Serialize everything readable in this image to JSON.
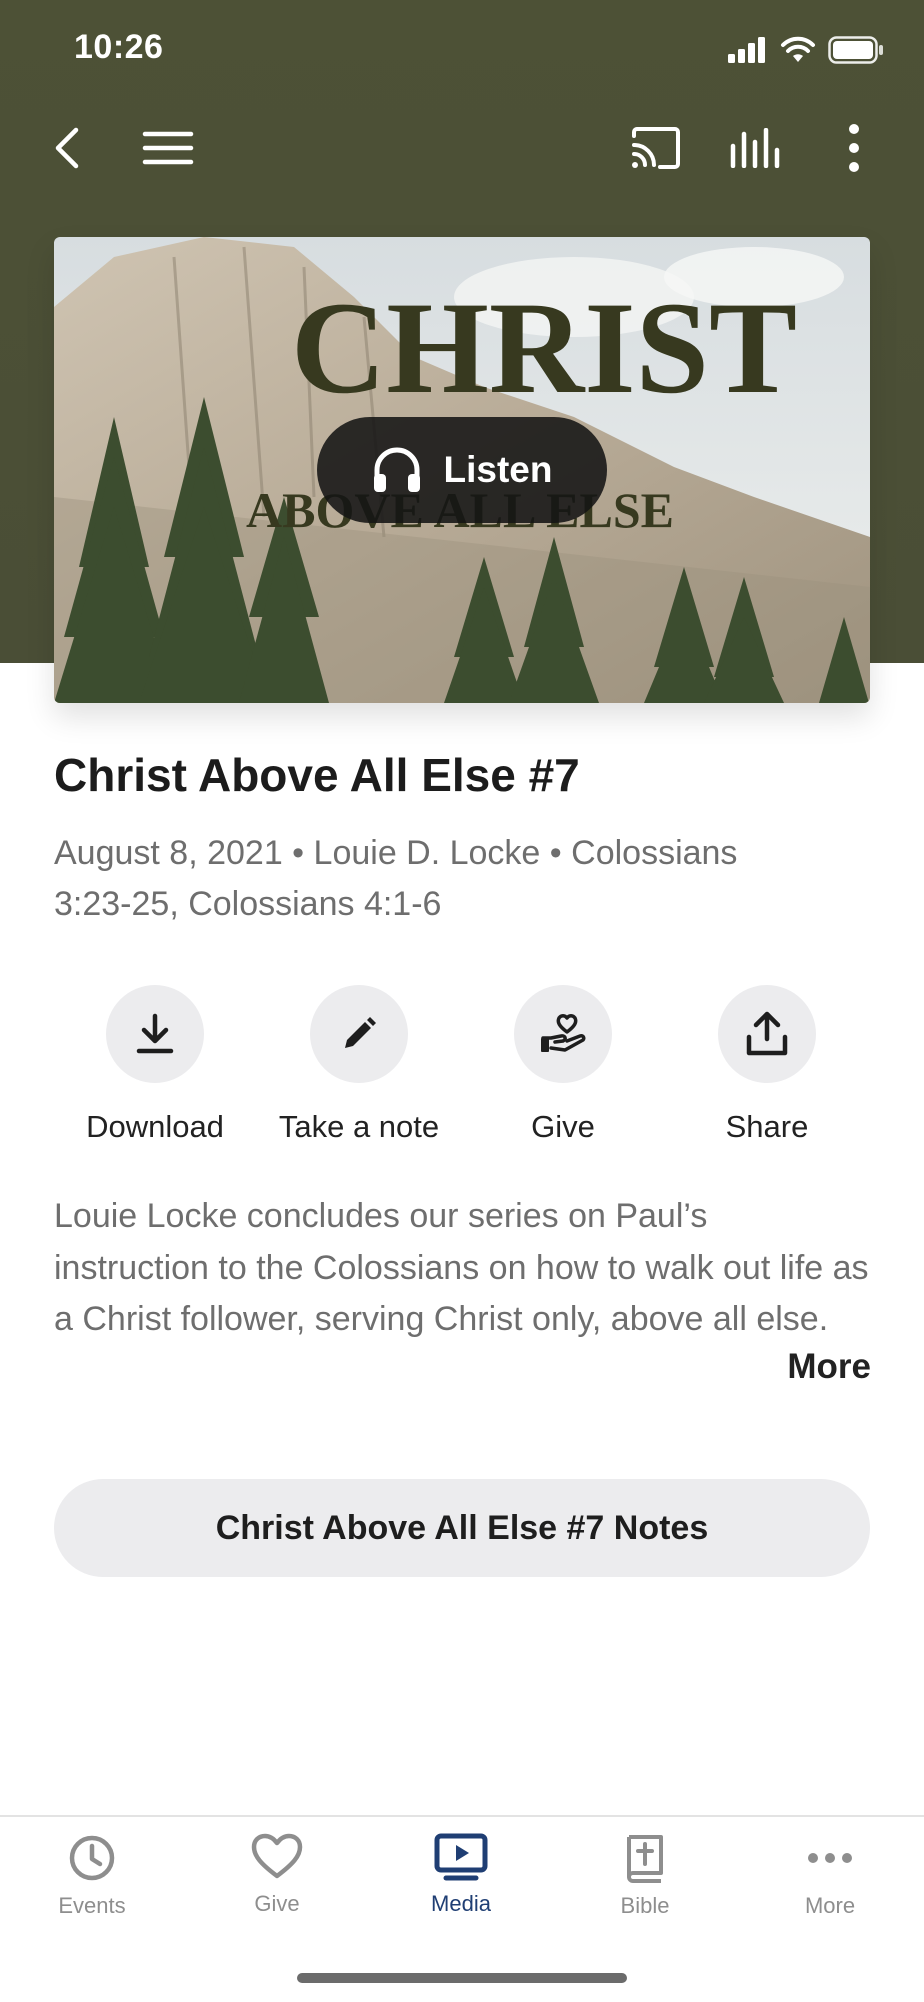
{
  "status_bar": {
    "time": "10:26"
  },
  "top_bar": {
    "icons": [
      "back-chevron-icon",
      "menu-icon",
      "cast-icon",
      "audio-bars-icon",
      "more-vertical-icon"
    ]
  },
  "artwork": {
    "title_line1": "CHRIST",
    "title_line2": "ABOVE ALL ELSE",
    "listen_label": "Listen"
  },
  "sermon": {
    "title": "Christ Above All Else #7",
    "meta_line1": "August 8, 2021 • Louie D. Locke • Colossians",
    "meta_line2": "3:23-25, Colossians 4:1-6"
  },
  "actions": [
    {
      "label": "Download",
      "icon": "download-icon"
    },
    {
      "label": "Take a note",
      "icon": "pencil-icon"
    },
    {
      "label": "Give",
      "icon": "heart-hand-icon"
    },
    {
      "label": "Share",
      "icon": "share-icon"
    }
  ],
  "description": {
    "text": "Louie Locke concludes our series on Paul’s instruction to the Colossians on how to walk out life as a Christ follower, serving Christ only, above all else.",
    "more_label": "More"
  },
  "notes_button": {
    "label": "Christ Above All Else #7 Notes"
  },
  "tab_bar": {
    "active_color": "#1f3e73",
    "inactive_color": "#8e8e8e",
    "tabs": [
      {
        "label": "Events",
        "icon": "clock-icon",
        "active": false
      },
      {
        "label": "Give",
        "icon": "heart-icon",
        "active": false
      },
      {
        "label": "Media",
        "icon": "media-play-icon",
        "active": true
      },
      {
        "label": "Bible",
        "icon": "bible-icon",
        "active": false
      },
      {
        "label": "More",
        "icon": "more-dots-icon",
        "active": false
      }
    ]
  },
  "colors": {
    "header_bg": "#4b4f36",
    "button_bg": "#ececee"
  }
}
